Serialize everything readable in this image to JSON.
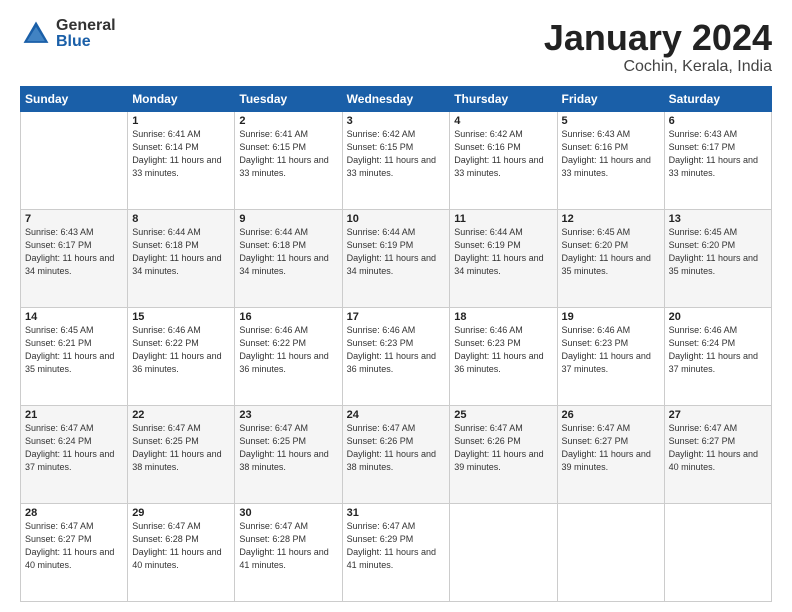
{
  "logo": {
    "general": "General",
    "blue": "Blue"
  },
  "title": "January 2024",
  "subtitle": "Cochin, Kerala, India",
  "headers": [
    "Sunday",
    "Monday",
    "Tuesday",
    "Wednesday",
    "Thursday",
    "Friday",
    "Saturday"
  ],
  "weeks": [
    [
      {
        "day": "",
        "sunrise": "",
        "sunset": "",
        "daylight": ""
      },
      {
        "day": "1",
        "sunrise": "Sunrise: 6:41 AM",
        "sunset": "Sunset: 6:14 PM",
        "daylight": "Daylight: 11 hours and 33 minutes."
      },
      {
        "day": "2",
        "sunrise": "Sunrise: 6:41 AM",
        "sunset": "Sunset: 6:15 PM",
        "daylight": "Daylight: 11 hours and 33 minutes."
      },
      {
        "day": "3",
        "sunrise": "Sunrise: 6:42 AM",
        "sunset": "Sunset: 6:15 PM",
        "daylight": "Daylight: 11 hours and 33 minutes."
      },
      {
        "day": "4",
        "sunrise": "Sunrise: 6:42 AM",
        "sunset": "Sunset: 6:16 PM",
        "daylight": "Daylight: 11 hours and 33 minutes."
      },
      {
        "day": "5",
        "sunrise": "Sunrise: 6:43 AM",
        "sunset": "Sunset: 6:16 PM",
        "daylight": "Daylight: 11 hours and 33 minutes."
      },
      {
        "day": "6",
        "sunrise": "Sunrise: 6:43 AM",
        "sunset": "Sunset: 6:17 PM",
        "daylight": "Daylight: 11 hours and 33 minutes."
      }
    ],
    [
      {
        "day": "7",
        "sunrise": "Sunrise: 6:43 AM",
        "sunset": "Sunset: 6:17 PM",
        "daylight": "Daylight: 11 hours and 34 minutes."
      },
      {
        "day": "8",
        "sunrise": "Sunrise: 6:44 AM",
        "sunset": "Sunset: 6:18 PM",
        "daylight": "Daylight: 11 hours and 34 minutes."
      },
      {
        "day": "9",
        "sunrise": "Sunrise: 6:44 AM",
        "sunset": "Sunset: 6:18 PM",
        "daylight": "Daylight: 11 hours and 34 minutes."
      },
      {
        "day": "10",
        "sunrise": "Sunrise: 6:44 AM",
        "sunset": "Sunset: 6:19 PM",
        "daylight": "Daylight: 11 hours and 34 minutes."
      },
      {
        "day": "11",
        "sunrise": "Sunrise: 6:44 AM",
        "sunset": "Sunset: 6:19 PM",
        "daylight": "Daylight: 11 hours and 34 minutes."
      },
      {
        "day": "12",
        "sunrise": "Sunrise: 6:45 AM",
        "sunset": "Sunset: 6:20 PM",
        "daylight": "Daylight: 11 hours and 35 minutes."
      },
      {
        "day": "13",
        "sunrise": "Sunrise: 6:45 AM",
        "sunset": "Sunset: 6:20 PM",
        "daylight": "Daylight: 11 hours and 35 minutes."
      }
    ],
    [
      {
        "day": "14",
        "sunrise": "Sunrise: 6:45 AM",
        "sunset": "Sunset: 6:21 PM",
        "daylight": "Daylight: 11 hours and 35 minutes."
      },
      {
        "day": "15",
        "sunrise": "Sunrise: 6:46 AM",
        "sunset": "Sunset: 6:22 PM",
        "daylight": "Daylight: 11 hours and 36 minutes."
      },
      {
        "day": "16",
        "sunrise": "Sunrise: 6:46 AM",
        "sunset": "Sunset: 6:22 PM",
        "daylight": "Daylight: 11 hours and 36 minutes."
      },
      {
        "day": "17",
        "sunrise": "Sunrise: 6:46 AM",
        "sunset": "Sunset: 6:23 PM",
        "daylight": "Daylight: 11 hours and 36 minutes."
      },
      {
        "day": "18",
        "sunrise": "Sunrise: 6:46 AM",
        "sunset": "Sunset: 6:23 PM",
        "daylight": "Daylight: 11 hours and 36 minutes."
      },
      {
        "day": "19",
        "sunrise": "Sunrise: 6:46 AM",
        "sunset": "Sunset: 6:23 PM",
        "daylight": "Daylight: 11 hours and 37 minutes."
      },
      {
        "day": "20",
        "sunrise": "Sunrise: 6:46 AM",
        "sunset": "Sunset: 6:24 PM",
        "daylight": "Daylight: 11 hours and 37 minutes."
      }
    ],
    [
      {
        "day": "21",
        "sunrise": "Sunrise: 6:47 AM",
        "sunset": "Sunset: 6:24 PM",
        "daylight": "Daylight: 11 hours and 37 minutes."
      },
      {
        "day": "22",
        "sunrise": "Sunrise: 6:47 AM",
        "sunset": "Sunset: 6:25 PM",
        "daylight": "Daylight: 11 hours and 38 minutes."
      },
      {
        "day": "23",
        "sunrise": "Sunrise: 6:47 AM",
        "sunset": "Sunset: 6:25 PM",
        "daylight": "Daylight: 11 hours and 38 minutes."
      },
      {
        "day": "24",
        "sunrise": "Sunrise: 6:47 AM",
        "sunset": "Sunset: 6:26 PM",
        "daylight": "Daylight: 11 hours and 38 minutes."
      },
      {
        "day": "25",
        "sunrise": "Sunrise: 6:47 AM",
        "sunset": "Sunset: 6:26 PM",
        "daylight": "Daylight: 11 hours and 39 minutes."
      },
      {
        "day": "26",
        "sunrise": "Sunrise: 6:47 AM",
        "sunset": "Sunset: 6:27 PM",
        "daylight": "Daylight: 11 hours and 39 minutes."
      },
      {
        "day": "27",
        "sunrise": "Sunrise: 6:47 AM",
        "sunset": "Sunset: 6:27 PM",
        "daylight": "Daylight: 11 hours and 40 minutes."
      }
    ],
    [
      {
        "day": "28",
        "sunrise": "Sunrise: 6:47 AM",
        "sunset": "Sunset: 6:27 PM",
        "daylight": "Daylight: 11 hours and 40 minutes."
      },
      {
        "day": "29",
        "sunrise": "Sunrise: 6:47 AM",
        "sunset": "Sunset: 6:28 PM",
        "daylight": "Daylight: 11 hours and 40 minutes."
      },
      {
        "day": "30",
        "sunrise": "Sunrise: 6:47 AM",
        "sunset": "Sunset: 6:28 PM",
        "daylight": "Daylight: 11 hours and 41 minutes."
      },
      {
        "day": "31",
        "sunrise": "Sunrise: 6:47 AM",
        "sunset": "Sunset: 6:29 PM",
        "daylight": "Daylight: 11 hours and 41 minutes."
      },
      {
        "day": "",
        "sunrise": "",
        "sunset": "",
        "daylight": ""
      },
      {
        "day": "",
        "sunrise": "",
        "sunset": "",
        "daylight": ""
      },
      {
        "day": "",
        "sunrise": "",
        "sunset": "",
        "daylight": ""
      }
    ]
  ]
}
